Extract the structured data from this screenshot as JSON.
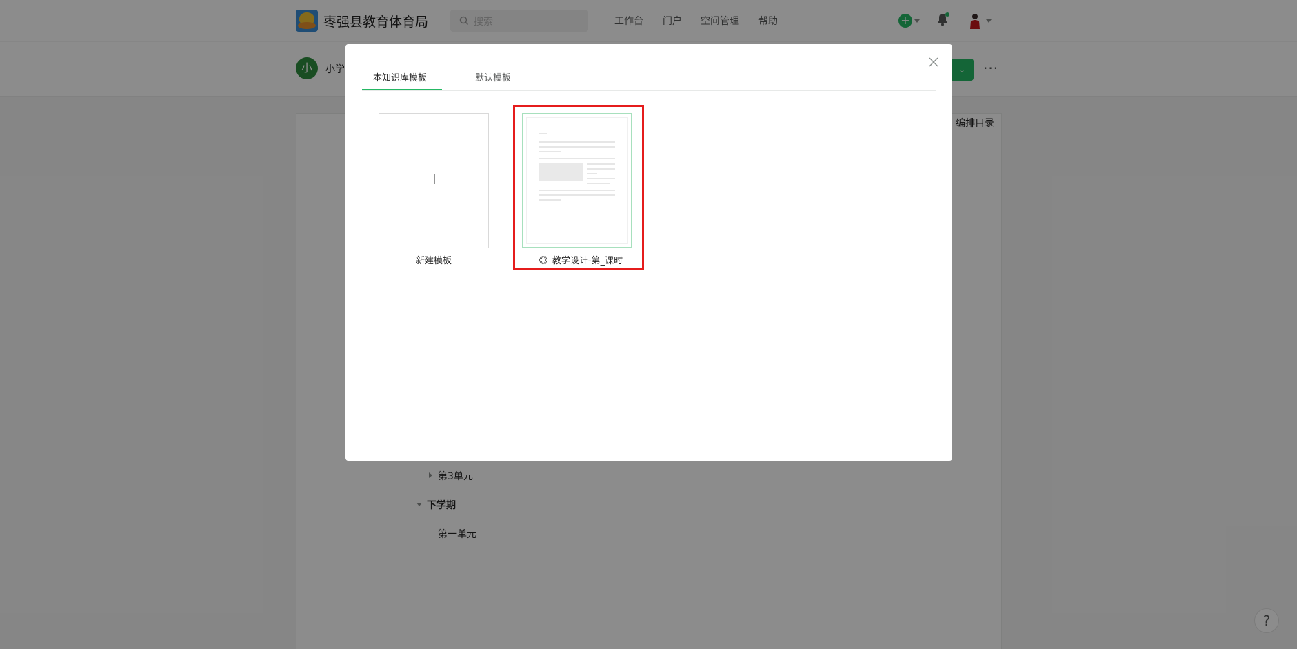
{
  "header": {
    "brand": "枣强县教育体育局",
    "search_placeholder": "搜索",
    "nav": [
      "工作台",
      "门户",
      "空间管理",
      "帮助"
    ],
    "add_symbol": "+"
  },
  "subheader": {
    "avatar_initial": "小",
    "kb_title": "小学",
    "more": "···"
  },
  "content": {
    "edit_toc_label": "编排目录",
    "toc": [
      {
        "label": "第3单元",
        "expanded": false
      },
      {
        "label": "下学期",
        "expanded": true
      },
      {
        "label": "第一单元"
      }
    ]
  },
  "help_label": "?",
  "modal": {
    "tabs": [
      {
        "label": "本知识库模板",
        "active": true
      },
      {
        "label": "默认模板",
        "active": false
      }
    ],
    "new_template": {
      "symbol": "+",
      "label": "新建模板"
    },
    "template": {
      "label": "《》教学设计-第_课时",
      "selected": true
    }
  },
  "colors": {
    "accent": "#25b864",
    "highlight": "#e51c1c",
    "mask": "rgba(0,0,0,0.45)"
  }
}
